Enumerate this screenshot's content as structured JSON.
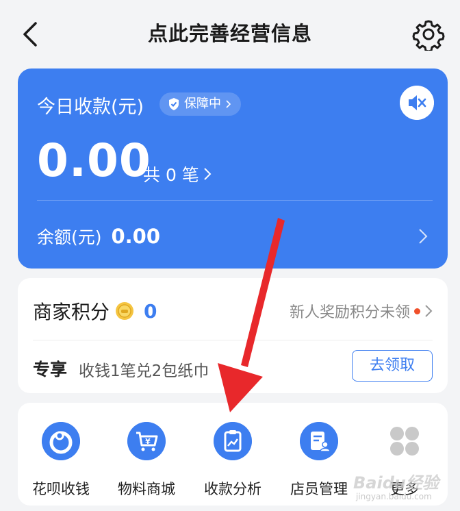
{
  "header": {
    "title": "点此完善经营信息",
    "back_icon": "back-chevron-icon",
    "settings_icon": "gear-icon"
  },
  "today_card": {
    "label": "今日收款(元)",
    "badge": "保障中",
    "amount": "0.00",
    "count_text": "共 0 笔",
    "balance_label": "余额(元)",
    "balance_value": "0.00",
    "mute_icon": "speaker-muted-icon",
    "accent": "#3d7ef0"
  },
  "points": {
    "label": "商家积分",
    "value": "0",
    "reward_text": "新人奖励积分未领",
    "exclusive_label": "专享",
    "promo_text": "收钱1笔兑2包纸巾",
    "claim_button": "去领取"
  },
  "quick_actions": [
    {
      "label": "花呗收钱",
      "icon": "huabei-icon"
    },
    {
      "label": "物料商城",
      "icon": "shopping-cart-icon"
    },
    {
      "label": "收款分析",
      "icon": "analytics-clipboard-icon"
    },
    {
      "label": "店员管理",
      "icon": "staff-document-icon"
    },
    {
      "label": "更多",
      "icon": "more-grid-icon"
    }
  ],
  "watermark": {
    "text": "Baidu经验",
    "sub": "jingyan.baidu.com"
  }
}
